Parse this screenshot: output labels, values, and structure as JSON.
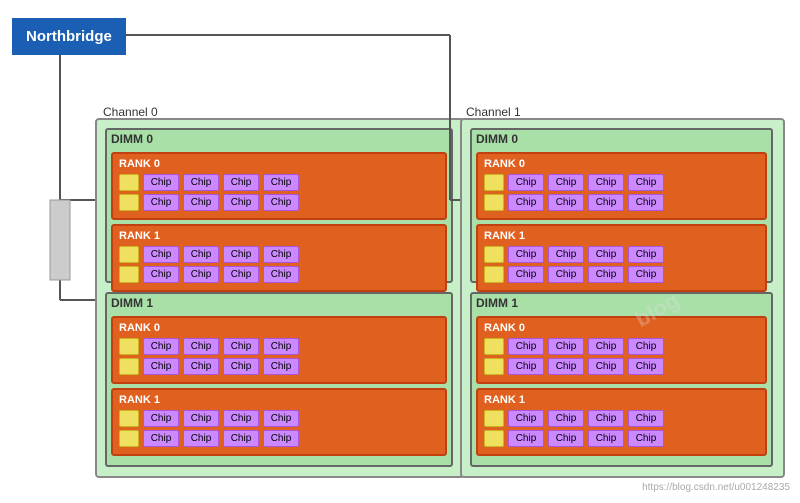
{
  "northbridge": {
    "label": "Northbridge"
  },
  "channels": [
    {
      "id": "channel0",
      "label": "Channel 0",
      "dimms": [
        {
          "id": "dimm0-ch0",
          "label": "DIMM 0",
          "ranks": [
            {
              "id": "rank0-dimm0-ch0",
              "label": "RANK 0",
              "rows": [
                [
                  "Chip",
                  "Chip",
                  "Chip",
                  "Chip"
                ],
                [
                  "Chip",
                  "Chip",
                  "Chip",
                  "Chip"
                ]
              ]
            },
            {
              "id": "rank1-dimm0-ch0",
              "label": "RANK 1",
              "rows": [
                [
                  "Chip",
                  "Chip",
                  "Chip",
                  "Chip"
                ],
                [
                  "Chip",
                  "Chip",
                  "Chip",
                  "Chip"
                ]
              ]
            }
          ]
        },
        {
          "id": "dimm1-ch0",
          "label": "DIMM 1",
          "ranks": [
            {
              "id": "rank0-dimm1-ch0",
              "label": "RANK 0",
              "rows": [
                [
                  "Chip",
                  "Chip",
                  "Chip",
                  "Chip"
                ],
                [
                  "Chip",
                  "Chip",
                  "Chip",
                  "Chip"
                ]
              ]
            },
            {
              "id": "rank1-dimm1-ch0",
              "label": "RANK 1",
              "rows": [
                [
                  "Chip",
                  "Chip",
                  "Chip",
                  "Chip"
                ],
                [
                  "Chip",
                  "Chip",
                  "Chip",
                  "Chip"
                ]
              ]
            }
          ]
        }
      ]
    },
    {
      "id": "channel1",
      "label": "Channel 1",
      "dimms": [
        {
          "id": "dimm0-ch1",
          "label": "DIMM 0",
          "ranks": [
            {
              "id": "rank0-dimm0-ch1",
              "label": "RANK 0",
              "rows": [
                [
                  "Chip",
                  "Chip",
                  "Chip",
                  "Chip"
                ],
                [
                  "Chip",
                  "Chip",
                  "Chip",
                  "Chip"
                ]
              ]
            },
            {
              "id": "rank1-dimm0-ch1",
              "label": "RANK 1",
              "rows": [
                [
                  "Chip",
                  "Chip",
                  "Chip",
                  "Chip"
                ],
                [
                  "Chip",
                  "Chip",
                  "Chip",
                  "Chip"
                ]
              ]
            }
          ]
        },
        {
          "id": "dimm1-ch1",
          "label": "DIMM 1",
          "ranks": [
            {
              "id": "rank0-dimm1-ch1",
              "label": "RANK 0",
              "rows": [
                [
                  "Chip",
                  "Chip",
                  "Chip",
                  "Chip"
                ],
                [
                  "Chip",
                  "Chip",
                  "Chip",
                  "Chip"
                ]
              ]
            },
            {
              "id": "rank1-dimm1-ch1",
              "label": "RANK 1",
              "rows": [
                [
                  "Chip",
                  "Chip",
                  "Chip",
                  "Chip"
                ],
                [
                  "Chip",
                  "Chip",
                  "Chip",
                  "Chip"
                ]
              ]
            }
          ]
        }
      ]
    }
  ],
  "watermark": "https://blog.csdn.net/u001248235"
}
